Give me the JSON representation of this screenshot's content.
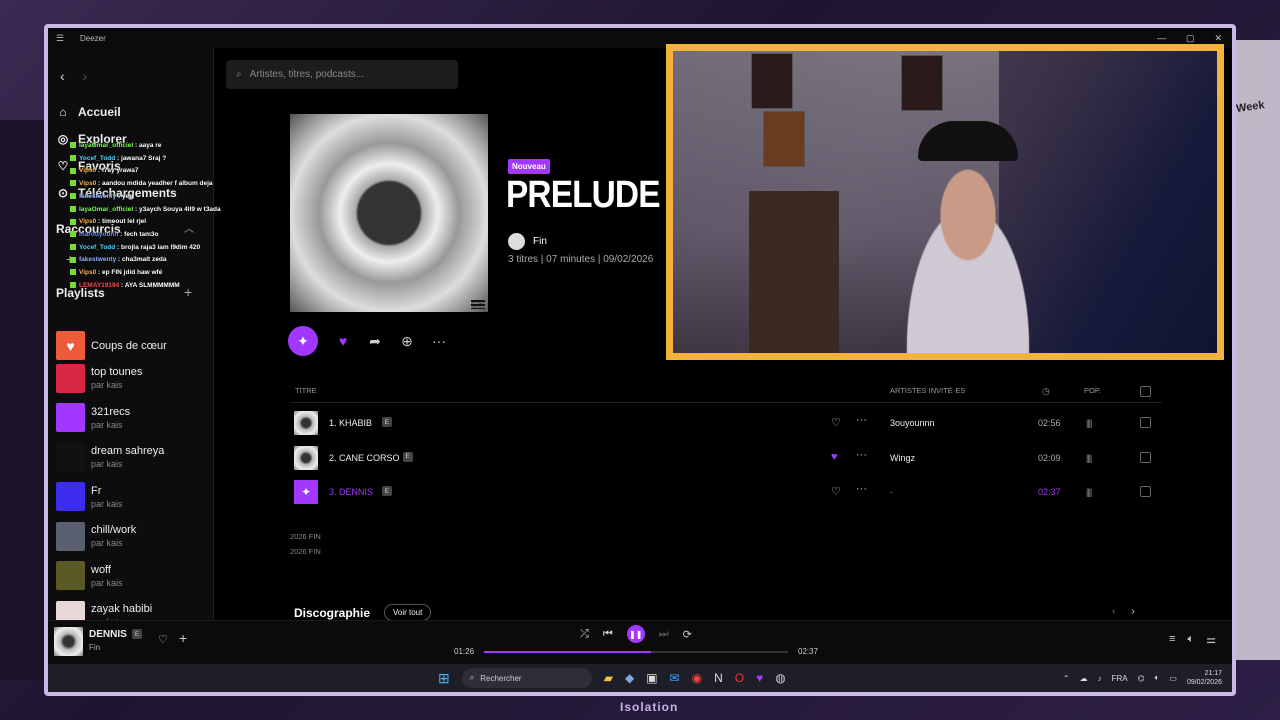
{
  "app": {
    "title": "Deezer"
  },
  "overlay": {
    "brand": "Isolation",
    "side_text": "Week"
  },
  "search": {
    "placeholder": "Artistes, titres, podcasts..."
  },
  "nav": [
    {
      "label": "Accueil",
      "icon": "home-icon"
    },
    {
      "label": "Explorer",
      "icon": "compass-icon"
    },
    {
      "label": "Favoris",
      "icon": "heart-icon"
    },
    {
      "label": "Téléchargements",
      "icon": "download-icon"
    }
  ],
  "sections": {
    "shortcuts": "Raccourcis",
    "playlists": "Playlists"
  },
  "chat": [
    {
      "user": "IayaOmar_officiel",
      "color": "#7dff5a",
      "msg": "aaya re"
    },
    {
      "user": "Yocef_Todd",
      "color": "#4fd6ff",
      "msg": "jawana7 Sraj ?"
    },
    {
      "user": "Vips0",
      "color": "#ffb347",
      "msg": "l7ay yrawa7"
    },
    {
      "user": "Vips0",
      "color": "#ffb347",
      "msg": "aandou mdida yeadher f album deja"
    },
    {
      "user": "fakestwenty",
      "color": "#8ab4ff",
      "msg": "yep"
    },
    {
      "user": "IayaOmar_officiel",
      "color": "#7dff5a",
      "msg": "y3aych Souya 4ll9 w t3ada"
    },
    {
      "user": "Vips0",
      "color": "#ffb347",
      "msg": "timeout lel rjel"
    },
    {
      "user": "marouyounn",
      "color": "#6b8cff",
      "msg": "fech tam3o"
    },
    {
      "user": "Yocef_Todd",
      "color": "#4fd6ff",
      "msg": "brojla raja3 iam l9dim 420"
    },
    {
      "user": "fakestwenty",
      "color": "#8ab4ff",
      "msg": "cha3malt zeda"
    },
    {
      "user": "Vips0",
      "color": "#ffb347",
      "msg": "ep FIN jdid haw wfé"
    },
    {
      "user": "LEMAY19194",
      "color": "#ff4d4d",
      "msg": "AYA SLMMMMMM"
    }
  ],
  "playlists": [
    {
      "name": "Coups de cœur",
      "owner": "",
      "color": "#ef5a3a",
      "icon": "♥"
    },
    {
      "name": "top tounes",
      "owner": "par kais",
      "color": "#d92843",
      "icon": ""
    },
    {
      "name": "321recs",
      "owner": "par kais",
      "color": "#a238ff",
      "icon": ""
    },
    {
      "name": "dream sahreya",
      "owner": "par kais",
      "color": "#111111",
      "icon": ""
    },
    {
      "name": "Fr",
      "owner": "par kais",
      "color": "#3b2cf0",
      "icon": ""
    },
    {
      "name": "chill/work",
      "owner": "par kais",
      "color": "#5a6070",
      "icon": ""
    },
    {
      "name": "woff",
      "owner": "par kais",
      "color": "#5a5a24",
      "icon": ""
    },
    {
      "name": "zayak habibi",
      "owner": "par kais",
      "color": "#e8d7d7",
      "icon": ""
    }
  ],
  "album": {
    "badge": "Nouveau",
    "title": "PRELUDE",
    "artist": "Fin",
    "meta": "3 titres | 07 minutes | 09/02/2026",
    "parental": "PARENTAL ADVISORY"
  },
  "table": {
    "col_title": "TITRE",
    "col_featured": "ARTISTES INVITÉ·ES",
    "col_pop": "POP."
  },
  "tracks": [
    {
      "title": "1. KHABIB",
      "explicit": "E",
      "featured": "3ouyounnn",
      "duration": "02:56",
      "liked": false,
      "playing": false
    },
    {
      "title": "2. CANE CORSO",
      "explicit": "E",
      "featured": "Wingz",
      "duration": "02:09",
      "liked": true,
      "playing": false
    },
    {
      "title": "3. DENNIS",
      "explicit": "E",
      "featured": "-",
      "duration": "02:37",
      "liked": false,
      "playing": true
    }
  ],
  "copyright": [
    "2026 FIN",
    "2026 FIN"
  ],
  "discography": {
    "title": "Discographie",
    "see_all": "Voir tout"
  },
  "player": {
    "title": "DENNIS",
    "explicit": "E",
    "artist": "Fin",
    "elapsed": "01:26",
    "total": "02:37",
    "progress": 0.548
  },
  "taskbar": {
    "search": "Rechercher",
    "lang": "FRA",
    "time": "21:17",
    "date": "09/02/2026"
  },
  "colors": {
    "accent": "#a238ff",
    "cam_border": "#f2b33d"
  }
}
